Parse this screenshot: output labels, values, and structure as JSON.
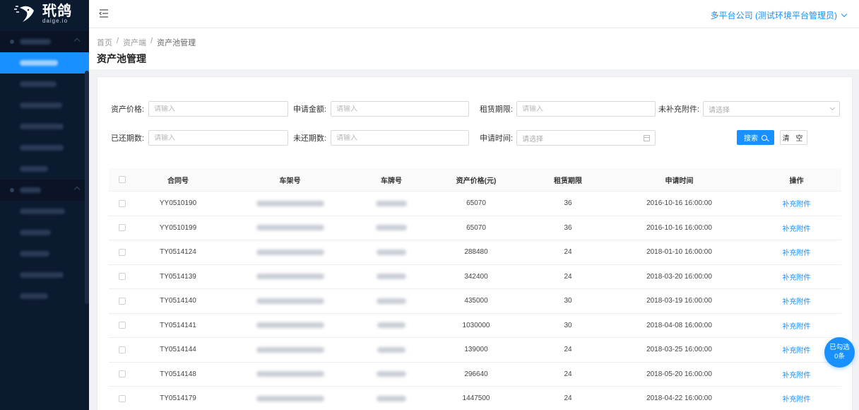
{
  "brand": {
    "name": "玳鸽",
    "sub": "daige.io"
  },
  "header": {
    "user_menu": "多平台公司 (测试环境平台管理员)"
  },
  "breadcrumb": [
    "首页",
    "资产端",
    "资产池管理"
  ],
  "page_title": "资产池管理",
  "filters": {
    "price": {
      "label": "资产价格:",
      "placeholder": "请输入"
    },
    "amount": {
      "label": "申请金额:",
      "placeholder": "请输入"
    },
    "term": {
      "label": "租赁期限:",
      "placeholder": "请输入"
    },
    "attachment": {
      "label": "未补充附件:",
      "placeholder": "请选择"
    },
    "paid_periods": {
      "label": "已还期数:",
      "placeholder": "请输入"
    },
    "unpaid_periods": {
      "label": "未还期数:",
      "placeholder": "请输入"
    },
    "apply_time": {
      "label": "申请时间:",
      "placeholder": "请选择"
    }
  },
  "buttons": {
    "search": "搜索",
    "clear": "清 空"
  },
  "table": {
    "headers": [
      "合同号",
      "车架号",
      "车牌号",
      "资产价格(元)",
      "租赁期限",
      "申请时间",
      "操作"
    ],
    "rows": [
      {
        "contract": "YY0510190",
        "price": "65070",
        "term": "36",
        "time": "2016-10-16 16:00:00",
        "op": "补充附件"
      },
      {
        "contract": "YY0510199",
        "price": "65070",
        "term": "36",
        "time": "2016-10-16 16:00:00",
        "op": "补充附件"
      },
      {
        "contract": "TY0514124",
        "price": "288480",
        "term": "24",
        "time": "2018-01-10 16:00:00",
        "op": "补充附件"
      },
      {
        "contract": "TY0514139",
        "price": "342400",
        "term": "24",
        "time": "2018-03-20 16:00:00",
        "op": "补充附件"
      },
      {
        "contract": "TY0514140",
        "price": "435000",
        "term": "30",
        "time": "2018-03-19 16:00:00",
        "op": "补充附件"
      },
      {
        "contract": "TY0514141",
        "price": "1030000",
        "term": "30",
        "time": "2018-04-08 16:00:00",
        "op": "补充附件"
      },
      {
        "contract": "TY0514144",
        "price": "139000",
        "term": "24",
        "time": "2018-03-25 16:00:00",
        "op": "补充附件"
      },
      {
        "contract": "TY0514148",
        "price": "296640",
        "term": "24",
        "time": "2018-05-20 16:00:00",
        "op": "补充附件"
      },
      {
        "contract": "TY0514179",
        "price": "1447500",
        "term": "24",
        "time": "2018-04-22 16:00:00",
        "op": "补充附件"
      }
    ]
  },
  "float_badge": {
    "line1": "已勾选",
    "line2": "0条"
  },
  "colors": {
    "primary": "#1890ff",
    "sidebar": "#0c1a30"
  }
}
